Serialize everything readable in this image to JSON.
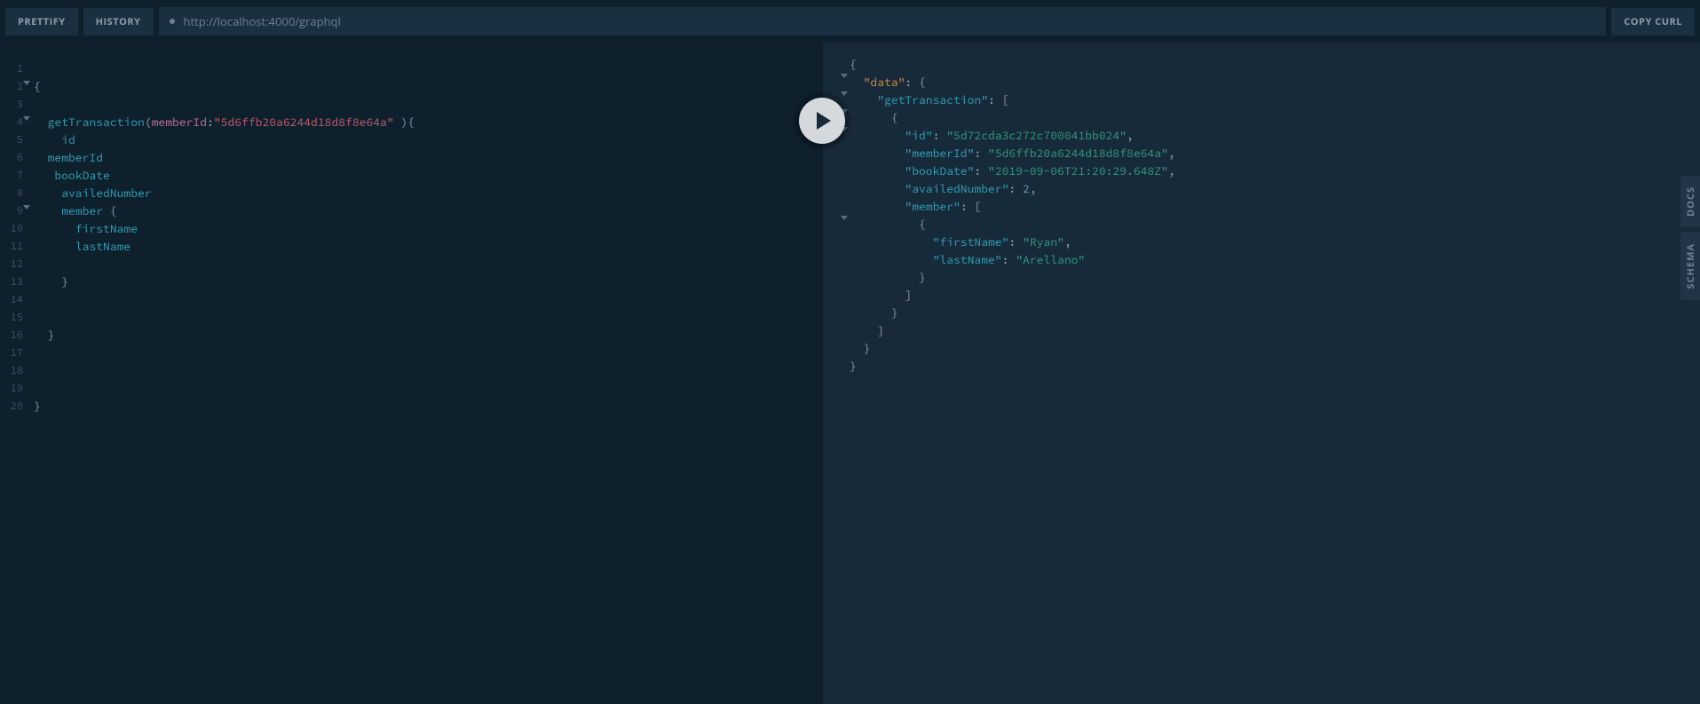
{
  "toolbar": {
    "prettify_label": "PRETTIFY",
    "history_label": "HISTORY",
    "copy_curl_label": "COPY CURL",
    "url": "http://localhost:4000/graphql"
  },
  "side_tabs": {
    "docs_label": "DOCS",
    "schema_label": "SCHEMA"
  },
  "query": {
    "lines": [
      {
        "n": 1,
        "fold": false,
        "tokens": []
      },
      {
        "n": 2,
        "fold": true,
        "tokens": [
          {
            "t": "punc",
            "v": "{"
          }
        ]
      },
      {
        "n": 3,
        "fold": false,
        "tokens": []
      },
      {
        "n": 4,
        "fold": true,
        "tokens": [
          {
            "t": "ws",
            "v": "  "
          },
          {
            "t": "field",
            "v": "getTransaction"
          },
          {
            "t": "punc",
            "v": "("
          },
          {
            "t": "arg",
            "v": "memberId"
          },
          {
            "t": "punc",
            "v": ":"
          },
          {
            "t": "string",
            "v": "\"5d6ffb20a6244d18d8f8e64a\""
          },
          {
            "t": "ws",
            "v": " "
          },
          {
            "t": "punc",
            "v": "){"
          }
        ]
      },
      {
        "n": 5,
        "fold": false,
        "tokens": [
          {
            "t": "ws",
            "v": "    "
          },
          {
            "t": "field",
            "v": "id"
          }
        ]
      },
      {
        "n": 6,
        "fold": false,
        "tokens": [
          {
            "t": "ws",
            "v": "  "
          },
          {
            "t": "field",
            "v": "memberId"
          }
        ]
      },
      {
        "n": 7,
        "fold": false,
        "tokens": [
          {
            "t": "ws",
            "v": "   "
          },
          {
            "t": "field",
            "v": "bookDate"
          }
        ]
      },
      {
        "n": 8,
        "fold": false,
        "tokens": [
          {
            "t": "ws",
            "v": "    "
          },
          {
            "t": "field",
            "v": "availedNumber"
          }
        ]
      },
      {
        "n": 9,
        "fold": true,
        "tokens": [
          {
            "t": "ws",
            "v": "    "
          },
          {
            "t": "field",
            "v": "member"
          },
          {
            "t": "ws",
            "v": " "
          },
          {
            "t": "punc",
            "v": "{"
          }
        ]
      },
      {
        "n": 10,
        "fold": false,
        "tokens": [
          {
            "t": "ws",
            "v": "      "
          },
          {
            "t": "field",
            "v": "firstName"
          }
        ]
      },
      {
        "n": 11,
        "fold": false,
        "tokens": [
          {
            "t": "ws",
            "v": "      "
          },
          {
            "t": "field",
            "v": "lastName"
          }
        ]
      },
      {
        "n": 12,
        "fold": false,
        "tokens": []
      },
      {
        "n": 13,
        "fold": false,
        "tokens": [
          {
            "t": "ws",
            "v": "    "
          },
          {
            "t": "punc",
            "v": "}"
          }
        ]
      },
      {
        "n": 14,
        "fold": false,
        "tokens": []
      },
      {
        "n": 15,
        "fold": false,
        "tokens": []
      },
      {
        "n": 16,
        "fold": false,
        "tokens": [
          {
            "t": "ws",
            "v": "  "
          },
          {
            "t": "punc",
            "v": "}"
          }
        ]
      },
      {
        "n": 17,
        "fold": false,
        "tokens": []
      },
      {
        "n": 18,
        "fold": false,
        "tokens": []
      },
      {
        "n": 19,
        "fold": false,
        "tokens": []
      },
      {
        "n": 20,
        "fold": false,
        "tokens": [
          {
            "t": "punc",
            "v": "}"
          }
        ]
      }
    ]
  },
  "result": {
    "lines": [
      {
        "fold": true,
        "indent": 0,
        "tokens": [
          {
            "t": "punc",
            "v": "{"
          }
        ]
      },
      {
        "fold": true,
        "indent": 1,
        "tokens": [
          {
            "t": "dkey",
            "v": "\"data\""
          },
          {
            "t": "punc",
            "v": ": {"
          }
        ]
      },
      {
        "fold": true,
        "indent": 2,
        "tokens": [
          {
            "t": "key",
            "v": "\"getTransaction\""
          },
          {
            "t": "punc",
            "v": ": ["
          }
        ]
      },
      {
        "fold": true,
        "indent": 3,
        "tokens": [
          {
            "t": "punc",
            "v": "{"
          }
        ]
      },
      {
        "fold": false,
        "indent": 4,
        "tokens": [
          {
            "t": "key",
            "v": "\"id\""
          },
          {
            "t": "punc",
            "v": ": "
          },
          {
            "t": "str",
            "v": "\"5d72cda3c272c700041bb024\""
          },
          {
            "t": "punc",
            "v": ","
          }
        ]
      },
      {
        "fold": false,
        "indent": 4,
        "tokens": [
          {
            "t": "key",
            "v": "\"memberId\""
          },
          {
            "t": "punc",
            "v": ": "
          },
          {
            "t": "str",
            "v": "\"5d6ffb20a6244d18d8f8e64a\""
          },
          {
            "t": "punc",
            "v": ","
          }
        ]
      },
      {
        "fold": false,
        "indent": 4,
        "tokens": [
          {
            "t": "key",
            "v": "\"bookDate\""
          },
          {
            "t": "punc",
            "v": ": "
          },
          {
            "t": "str",
            "v": "\"2019-09-06T21:20:29.648Z\""
          },
          {
            "t": "punc",
            "v": ","
          }
        ]
      },
      {
        "fold": false,
        "indent": 4,
        "tokens": [
          {
            "t": "key",
            "v": "\"availedNumber\""
          },
          {
            "t": "punc",
            "v": ": "
          },
          {
            "t": "num",
            "v": "2"
          },
          {
            "t": "punc",
            "v": ","
          }
        ]
      },
      {
        "fold": true,
        "indent": 4,
        "tokens": [
          {
            "t": "key",
            "v": "\"member\""
          },
          {
            "t": "punc",
            "v": ": ["
          }
        ]
      },
      {
        "fold": false,
        "indent": 5,
        "tokens": [
          {
            "t": "punc",
            "v": "{"
          }
        ]
      },
      {
        "fold": false,
        "indent": 6,
        "tokens": [
          {
            "t": "key",
            "v": "\"firstName\""
          },
          {
            "t": "punc",
            "v": ": "
          },
          {
            "t": "str",
            "v": "\"Ryan\""
          },
          {
            "t": "punc",
            "v": ","
          }
        ]
      },
      {
        "fold": false,
        "indent": 6,
        "tokens": [
          {
            "t": "key",
            "v": "\"lastName\""
          },
          {
            "t": "punc",
            "v": ": "
          },
          {
            "t": "str",
            "v": "\"Arellano\""
          }
        ]
      },
      {
        "fold": false,
        "indent": 5,
        "tokens": [
          {
            "t": "punc",
            "v": "}"
          }
        ]
      },
      {
        "fold": false,
        "indent": 4,
        "tokens": [
          {
            "t": "punc",
            "v": "]"
          }
        ]
      },
      {
        "fold": false,
        "indent": 3,
        "tokens": [
          {
            "t": "punc",
            "v": "}"
          }
        ]
      },
      {
        "fold": false,
        "indent": 2,
        "tokens": [
          {
            "t": "punc",
            "v": "]"
          }
        ]
      },
      {
        "fold": false,
        "indent": 1,
        "tokens": [
          {
            "t": "punc",
            "v": "}"
          }
        ]
      },
      {
        "fold": false,
        "indent": 0,
        "tokens": [
          {
            "t": "punc",
            "v": "}"
          }
        ]
      }
    ]
  }
}
